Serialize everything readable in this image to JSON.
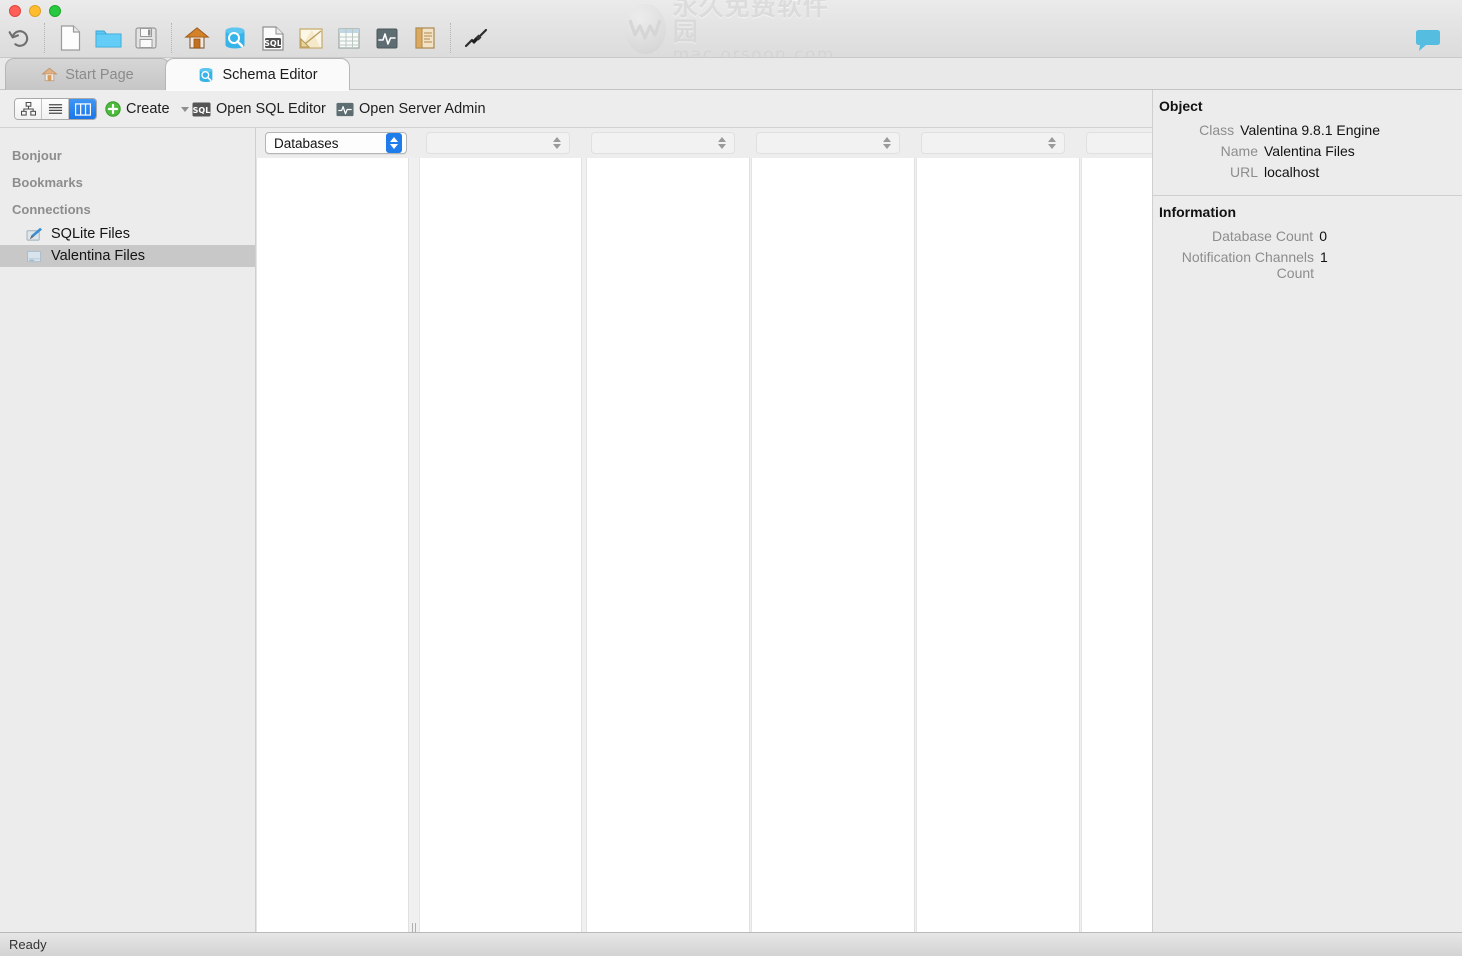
{
  "window": {
    "traffic_lights": [
      "close",
      "minimize",
      "zoom"
    ],
    "watermark_cn": "永久免费软件园",
    "watermark_en": "mac.orsoon.com"
  },
  "toolbar": {
    "items": [
      {
        "name": "undo-icon",
        "label": "Undo"
      },
      {
        "name": "new-document-icon",
        "label": "New"
      },
      {
        "name": "open-folder-icon",
        "label": "Open"
      },
      {
        "name": "save-floppy-icon",
        "label": "Save"
      },
      {
        "name": "home-icon",
        "label": "Start Page"
      },
      {
        "name": "schema-editor-icon",
        "label": "Schema Editor"
      },
      {
        "name": "sql-editor-icon",
        "label": "SQL Editor"
      },
      {
        "name": "diagram-icon",
        "label": "Diagram"
      },
      {
        "name": "data-editor-icon",
        "label": "Data Editor"
      },
      {
        "name": "server-admin-icon",
        "label": "Server Admin"
      },
      {
        "name": "report-editor-icon",
        "label": "Report Editor"
      },
      {
        "name": "plug-icon",
        "label": "Connect"
      }
    ],
    "chat_icon": "chat-bubble-icon"
  },
  "tabs": [
    {
      "label": "Start Page",
      "icon": "home-icon",
      "active": false
    },
    {
      "label": "Schema Editor",
      "icon": "schema-editor-icon",
      "active": true
    }
  ],
  "actionbar": {
    "view_modes": [
      {
        "name": "tree-view",
        "icon": "hierarchy-icon",
        "selected": false
      },
      {
        "name": "list-view",
        "icon": "list-icon",
        "selected": false
      },
      {
        "name": "column-view",
        "icon": "columns-icon",
        "selected": true
      }
    ],
    "create_label": "Create",
    "open_sql_editor_label": "Open SQL Editor",
    "open_server_admin_label": "Open Server Admin",
    "sql_badge": "SQL"
  },
  "search": {
    "value": "",
    "placeholder": "",
    "icon": "search-icon"
  },
  "sidebar": {
    "groups": [
      {
        "label": "Bonjour",
        "items": []
      },
      {
        "label": "Bookmarks",
        "items": []
      },
      {
        "label": "Connections",
        "items": [
          {
            "label": "SQLite Files",
            "icon": "sqlite-file-icon",
            "selected": false
          },
          {
            "label": "Valentina Files",
            "icon": "valentina-file-icon",
            "selected": true
          }
        ]
      }
    ]
  },
  "browser": {
    "columns": [
      {
        "selector": "Databases",
        "enabled": true
      },
      {
        "selector": "",
        "enabled": false
      },
      {
        "selector": "",
        "enabled": false
      },
      {
        "selector": "",
        "enabled": false
      },
      {
        "selector": "",
        "enabled": false
      },
      {
        "selector": "",
        "enabled": false
      }
    ]
  },
  "inspector": {
    "object": {
      "title": "Object",
      "rows": [
        {
          "key": "Class",
          "value": "Valentina 9.8.1 Engine"
        },
        {
          "key": "Name",
          "value": "Valentina Files"
        },
        {
          "key": "URL",
          "value": "localhost"
        }
      ]
    },
    "information": {
      "title": "Information",
      "rows": [
        {
          "key": "Database Count",
          "value": "0"
        },
        {
          "key": "Notification Channels Count",
          "value": "1"
        }
      ]
    }
  },
  "statusbar": {
    "text": "Ready"
  },
  "colors": {
    "accent": "#1f7ceb",
    "window_bg": "#ececec",
    "panel_bg": "#ffffff",
    "selection": "#c8c8c8"
  }
}
